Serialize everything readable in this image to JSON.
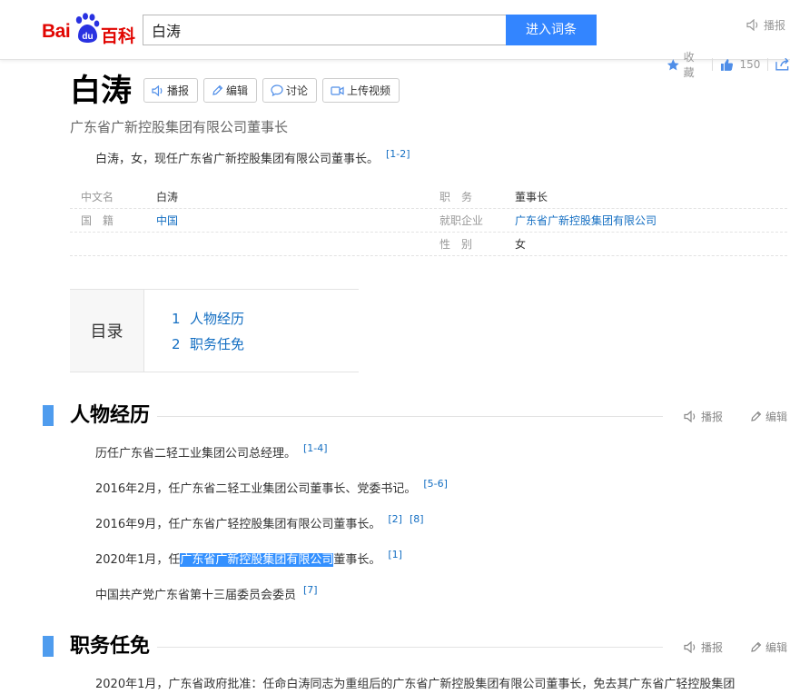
{
  "header": {
    "logo_left": "Bai",
    "logo_right": "百科",
    "search_value": "白涛",
    "search_button": "进入词条",
    "report_label": "播报"
  },
  "stats": {
    "favorite_label": "收藏",
    "like_count": "150"
  },
  "entry": {
    "title": "白涛",
    "tools": [
      {
        "label": "播报",
        "icon": "speaker-icon"
      },
      {
        "label": "编辑",
        "icon": "pencil-icon"
      },
      {
        "label": "讨论",
        "icon": "comment-icon"
      },
      {
        "label": "上传视频",
        "icon": "video-icon"
      }
    ],
    "subtitle": "广东省广新控股集团有限公司董事长",
    "summary": "白涛，女，现任广东省广新控股集团有限公司董事长。",
    "summary_ref": "[1-2]"
  },
  "info": {
    "rows": [
      {
        "k1": "中文名",
        "v1": "白涛",
        "k2": "职　务",
        "v2": "董事长"
      },
      {
        "k1": "国　籍",
        "v1": "中国",
        "k2": "就职企业",
        "v2": "广东省广新控股集团有限公司"
      },
      {
        "k1": "",
        "v1": "",
        "k2": "性　别",
        "v2": "女"
      }
    ]
  },
  "catalog": {
    "head": "目录",
    "items": [
      {
        "num": "1",
        "label": "人物经历"
      },
      {
        "num": "2",
        "label": "职务任免"
      }
    ]
  },
  "sections": {
    "s1": {
      "title": "人物经历",
      "report": "播报",
      "edit": "编辑",
      "paras": [
        {
          "text": "历任广东省二轻工业集团公司总经理。",
          "ref": "[1-4]"
        },
        {
          "text": "2016年2月，任广东省二轻工业集团公司董事长、党委书记。",
          "ref": "[5-6]"
        },
        {
          "text": "2016年9月，任广东省广轻控股集团有限公司董事长。",
          "ref": "[2]",
          "ref2": "[8]"
        },
        {
          "pre": "2020年1月，任",
          "hl": "广东省广新控股集团有限公司",
          "post": "董事长。",
          "ref": "[1]"
        },
        {
          "text": "中国共产党广东省第十三届委员会委员",
          "ref": "[7]"
        }
      ]
    },
    "s2": {
      "title": "职务任免",
      "report": "播报",
      "edit": "编辑",
      "para": "2020年1月，广东省政府批准：任命白涛同志为重组后的广东省广新控股集团有限公司董事长，免去其广东省广轻控股集团"
    }
  }
}
